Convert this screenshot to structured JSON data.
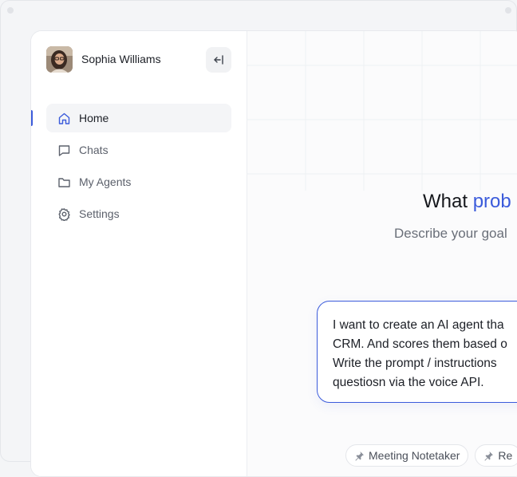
{
  "user": {
    "name": "Sophia Williams"
  },
  "sidebar": {
    "items": [
      {
        "label": "Home",
        "icon": "home-icon",
        "active": true
      },
      {
        "label": "Chats",
        "icon": "chat-icon",
        "active": false
      },
      {
        "label": "My Agents",
        "icon": "folder-icon",
        "active": false
      },
      {
        "label": "Settings",
        "icon": "gear-icon",
        "active": false
      }
    ]
  },
  "main": {
    "headline_prefix": "What ",
    "headline_accent": "prob",
    "subtitle": "Describe your goal",
    "prompt_lines": [
      "I want to create an AI agent tha",
      "CRM. And scores them based o",
      "Write the prompt / instructions",
      "questiosn via the voice API."
    ],
    "suggestions": [
      {
        "label": "Meeting Notetaker",
        "icon": "pin-icon"
      },
      {
        "label": "Re",
        "icon": "pin-icon"
      }
    ]
  },
  "colors": {
    "accent": "#3b5bdb",
    "text": "#1c1f26",
    "muted": "#5b606b"
  }
}
